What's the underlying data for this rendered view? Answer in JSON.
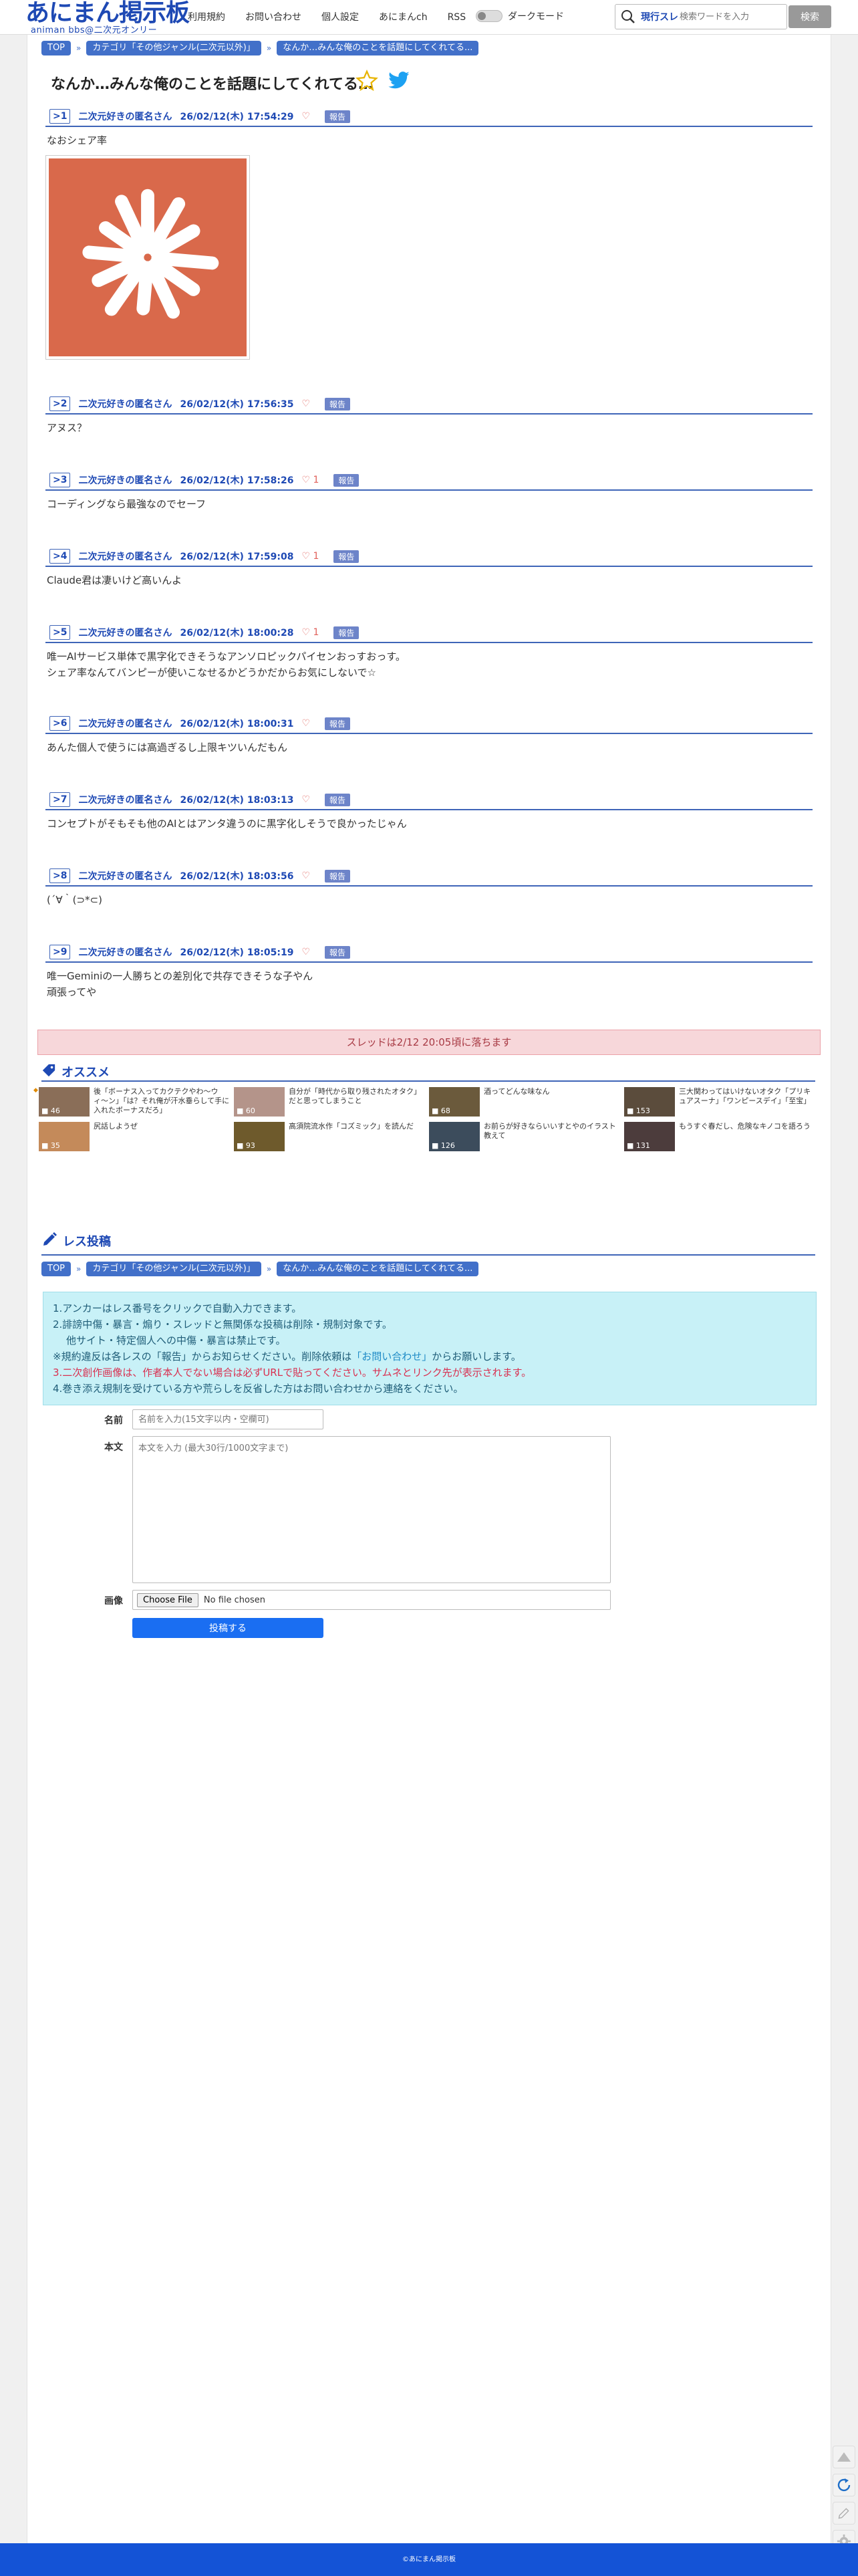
{
  "header": {
    "logo_main": "あにまん掲示板",
    "logo_sub": "animan bbs@二次元オンリー",
    "nav": [
      "利用規約",
      "お問い合わせ",
      "個人設定",
      "あにまんch",
      "RSS"
    ],
    "dark_mode_label": "ダークモード",
    "search_scope": "現行スレ",
    "search_placeholder": "検索ワードを入力",
    "search_button": "検索"
  },
  "breadcrumb": [
    "TOP",
    "カテゴリ「その他ジャンル(二次元以外)」",
    "なんか…みんな俺のことを話題にしてくれてる..."
  ],
  "thread": {
    "title": "なんか…みんな俺のことを話題にしてくれてる…"
  },
  "posts": [
    {
      "num": "1",
      "name": "二次元好きの匿名さん",
      "date": "26/02/12(木) 17:54:29",
      "likes": "",
      "report": "報告",
      "body": "なおシェア率",
      "has_image": true
    },
    {
      "num": "2",
      "name": "二次元好きの匿名さん",
      "date": "26/02/12(木) 17:56:35",
      "likes": "",
      "report": "報告",
      "body": "アヌス？"
    },
    {
      "num": "3",
      "name": "二次元好きの匿名さん",
      "date": "26/02/12(木) 17:58:26",
      "likes": "1",
      "report": "報告",
      "body": "コーディングなら最強なのでセーフ"
    },
    {
      "num": "4",
      "name": "二次元好きの匿名さん",
      "date": "26/02/12(木) 17:59:08",
      "likes": "1",
      "report": "報告",
      "body": "Claude君は凄いけど高いんよ"
    },
    {
      "num": "5",
      "name": "二次元好きの匿名さん",
      "date": "26/02/12(木) 18:00:28",
      "likes": "1",
      "report": "報告",
      "body": "唯一AIサービス単体で黒字化できそうなアンソロピックパイセンおっすおっす。\nシェア率なんてバンピーが使いこなせるかどうかだからお気にしないで☆"
    },
    {
      "num": "6",
      "name": "二次元好きの匿名さん",
      "date": "26/02/12(木) 18:00:31",
      "likes": "",
      "report": "報告",
      "body": "あんた個人で使うには高過ぎるし上限キツいんだもん"
    },
    {
      "num": "7",
      "name": "二次元好きの匿名さん",
      "date": "26/02/12(木) 18:03:13",
      "likes": "",
      "report": "報告",
      "body": "コンセプトがそもそも他のAIとはアンタ違うのに黒字化しそうで良かったじゃん"
    },
    {
      "num": "8",
      "name": "二次元好きの匿名さん",
      "date": "26/02/12(木) 18:03:56",
      "likes": "",
      "report": "報告",
      "body": "(´∀｀(⊃*⊂)"
    },
    {
      "num": "9",
      "name": "二次元好きの匿名さん",
      "date": "26/02/12(木) 18:05:19",
      "likes": "",
      "report": "報告",
      "body": "唯一Geminiの一人勝ちとの差別化で共存できそうな子やん\n頑張ってや"
    }
  ],
  "deletion_notice": "スレッドは2/12 20:05頃に落ちます",
  "recommend": {
    "title": "オススメ",
    "items": [
      {
        "count": "46",
        "text": "後「ボーナス入ってカクテクやわ〜ウィ〜ン」「は？それ俺が汗水垂らして手に入れたボーナスだろ」",
        "color": "#8a6e58"
      },
      {
        "count": "60",
        "text": "自分が「時代から取り残されたオタク」だと思ってしまうこと",
        "color": "#b4948a"
      },
      {
        "count": "68",
        "text": "酒ってどんな味なん",
        "color": "#6b5a3c"
      },
      {
        "count": "153",
        "text": "三大関わってはいけないオタク「プリキュアスーナ」「ワンピースデイ」「至宝」",
        "color": "#5b4c3c"
      },
      {
        "count": "35",
        "text": "尻話しようぜ",
        "color": "#c48a5a"
      },
      {
        "count": "93",
        "text": "高須院流水作「コズミック」を読んだ",
        "color": "#6e5a2c"
      },
      {
        "count": "126",
        "text": "お前らが好きならいいすとやのイラスト教えて",
        "color": "#3c4c5c"
      },
      {
        "count": "131",
        "text": "もうすぐ春だし、危険なキノコを語ろう",
        "color": "#4c3c3c"
      }
    ]
  },
  "reply": {
    "title": "レス投稿",
    "guide": [
      "1.アンカーはレス番号をクリックで自動入力できます。",
      "2.誹謗中傷・暴言・煽り・スレッドと無関係な投稿は削除・規制対象です。",
      "他サイト・特定個人への中傷・暴言は禁止です。",
      "※規約違反は各レスの「報告」からお知らせください。削除依頼は",
      "「お問い合わせ」",
      "からお願いします。",
      "3.二次創作画像は、作者本人でない場合は必ずURLで貼ってください。サムネとリンク先が表示されます。",
      "4.巻き添え規制を受けている方や荒らしを反省した方はお問い合わせから連絡をください。"
    ],
    "name_label": "名前",
    "name_placeholder": "名前を入力(15文字以内・空欄可)",
    "body_label": "本文",
    "body_placeholder": "本文を入力 (最大30行/1000文字まで)",
    "image_label": "画像",
    "file_button": "Choose File",
    "file_status": "No file chosen",
    "submit": "投稿する"
  },
  "footer": {
    "copyright": "©あにまん掲示板"
  },
  "colors": {
    "brand": "#1e49b4",
    "accent_line": "#3f65b8",
    "submit": "#1a6ef2",
    "footer": "#1453d6",
    "notice_bg": "#f7d7da"
  }
}
